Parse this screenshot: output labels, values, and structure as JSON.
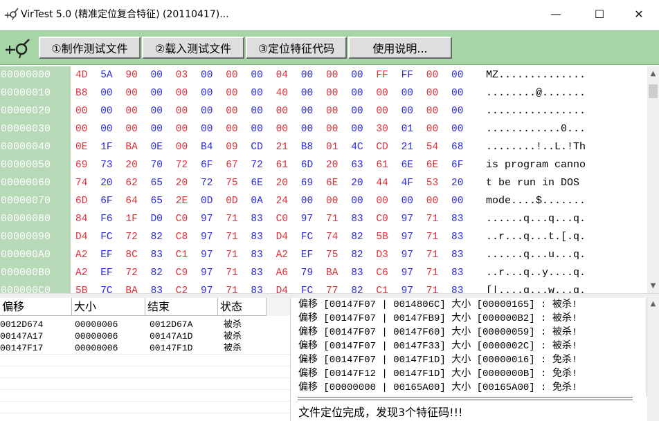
{
  "window": {
    "title": "VirTest 5.0 (精准定位复合特征) (20110417)...",
    "min_glyph": "—",
    "max_glyph": "☐",
    "close_glyph": "✕"
  },
  "toolbar": {
    "icon": "target-cursor-icon",
    "buttons": [
      {
        "label": "①制作测试文件"
      },
      {
        "label": "②载入测试文件"
      },
      {
        "label": "③定位特征代码"
      },
      {
        "label": "使用说明..."
      }
    ]
  },
  "hex": {
    "colors": {
      "red": "#e0303a",
      "blue": "#2a2adf",
      "addr_bg": "#b7d9b7"
    },
    "rows": [
      {
        "addr": "00000000",
        "bytes": [
          "4D",
          "5A",
          "90",
          "00",
          "03",
          "00",
          "00",
          "00",
          "04",
          "00",
          "00",
          "00",
          "FF",
          "FF",
          "00",
          "00"
        ],
        "ascii": "MZ.............."
      },
      {
        "addr": "00000010",
        "bytes": [
          "B8",
          "00",
          "00",
          "00",
          "00",
          "00",
          "00",
          "00",
          "40",
          "00",
          "00",
          "00",
          "00",
          "00",
          "00",
          "00"
        ],
        "ascii": "........@......."
      },
      {
        "addr": "00000020",
        "bytes": [
          "00",
          "00",
          "00",
          "00",
          "00",
          "00",
          "00",
          "00",
          "00",
          "00",
          "00",
          "00",
          "00",
          "00",
          "00",
          "00"
        ],
        "ascii": "................"
      },
      {
        "addr": "00000030",
        "bytes": [
          "00",
          "00",
          "00",
          "00",
          "00",
          "00",
          "00",
          "00",
          "00",
          "00",
          "00",
          "00",
          "30",
          "01",
          "00",
          "00"
        ],
        "ascii": "............0..."
      },
      {
        "addr": "00000040",
        "bytes": [
          "0E",
          "1F",
          "BA",
          "0E",
          "00",
          "B4",
          "09",
          "CD",
          "21",
          "B8",
          "01",
          "4C",
          "CD",
          "21",
          "54",
          "68"
        ],
        "ascii": "........!..L.!Th"
      },
      {
        "addr": "00000050",
        "bytes": [
          "69",
          "73",
          "20",
          "70",
          "72",
          "6F",
          "67",
          "72",
          "61",
          "6D",
          "20",
          "63",
          "61",
          "6E",
          "6E",
          "6F"
        ],
        "ascii": "is program canno"
      },
      {
        "addr": "00000060",
        "bytes": [
          "74",
          "20",
          "62",
          "65",
          "20",
          "72",
          "75",
          "6E",
          "20",
          "69",
          "6E",
          "20",
          "44",
          "4F",
          "53",
          "20"
        ],
        "ascii": "t be run in DOS "
      },
      {
        "addr": "00000070",
        "bytes": [
          "6D",
          "6F",
          "64",
          "65",
          "2E",
          "0D",
          "0D",
          "0A",
          "24",
          "00",
          "00",
          "00",
          "00",
          "00",
          "00",
          "00"
        ],
        "ascii": "mode....$......."
      },
      {
        "addr": "00000080",
        "bytes": [
          "84",
          "F6",
          "1F",
          "D0",
          "C0",
          "97",
          "71",
          "83",
          "C0",
          "97",
          "71",
          "83",
          "C0",
          "97",
          "71",
          "83"
        ],
        "ascii": "......q...q...q."
      },
      {
        "addr": "00000090",
        "bytes": [
          "D4",
          "FC",
          "72",
          "82",
          "C8",
          "97",
          "71",
          "83",
          "D4",
          "FC",
          "74",
          "82",
          "5B",
          "97",
          "71",
          "83"
        ],
        "ascii": "..r...q...t.[.q."
      },
      {
        "addr": "000000A0",
        "bytes": [
          "A2",
          "EF",
          "8C",
          "83",
          "C1",
          "97",
          "71",
          "83",
          "A2",
          "EF",
          "75",
          "82",
          "D3",
          "97",
          "71",
          "83"
        ],
        "ascii": "......q...u...q."
      },
      {
        "addr": "000000B0",
        "bytes": [
          "A2",
          "EF",
          "72",
          "82",
          "C9",
          "97",
          "71",
          "83",
          "A6",
          "79",
          "BA",
          "83",
          "C6",
          "97",
          "71",
          "83"
        ],
        "ascii": "..r...q..y....q."
      },
      {
        "addr": "000000C0",
        "bytes": [
          "5B",
          "7C",
          "BA",
          "83",
          "C2",
          "97",
          "71",
          "83",
          "D4",
          "FC",
          "77",
          "82",
          "C1",
          "97",
          "71",
          "83"
        ],
        "ascii": "[|....q...w...q."
      }
    ]
  },
  "list": {
    "headers": [
      "偏移",
      "大小",
      "结束",
      "状态"
    ],
    "rows": [
      {
        "offset": "0012D674",
        "size": "00000006",
        "end": "0012D67A",
        "status": "被杀"
      },
      {
        "offset": "00147A17",
        "size": "00000006",
        "end": "00147A1D",
        "status": "被杀"
      },
      {
        "offset": "00147F17",
        "size": "00000006",
        "end": "00147F1D",
        "status": "被杀"
      }
    ]
  },
  "log": {
    "lines": [
      "偏移 [00147F07 | 0014806C] 大小 [00000165] : 被杀!",
      "偏移 [00147F07 | 00147FB9] 大小 [000000B2] : 被杀!",
      "偏移 [00147F07 | 00147F60] 大小 [00000059] : 被杀!",
      "偏移 [00147F07 | 00147F33] 大小 [0000002C] : 被杀!",
      "偏移 [00147F07 | 00147F1D] 大小 [00000016] : 免杀!",
      "偏移 [00147F12 | 00147F1D] 大小 [0000000B] : 免杀!",
      "偏移 [00000000 | 00165A00] 大小 [00165A00] : 免杀!"
    ],
    "status": "文件定位完成，发现3个特征码!!!"
  }
}
